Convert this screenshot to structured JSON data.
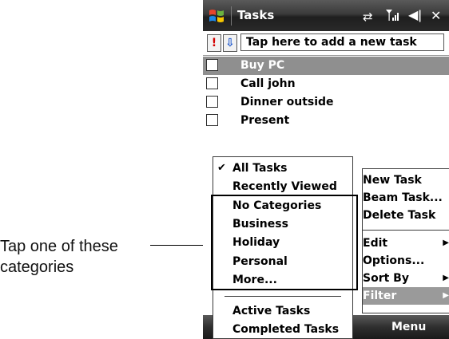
{
  "titlebar": {
    "title": "Tasks",
    "close_label": "✕"
  },
  "toolbar": {
    "priority_label": "!",
    "sort_label": "⇩",
    "new_task_placeholder": "Tap here to add a new task"
  },
  "tasks": [
    {
      "label": "Buy PC",
      "selected": true
    },
    {
      "label": "Call john",
      "selected": false
    },
    {
      "label": "Dinner outside",
      "selected": false
    },
    {
      "label": "Present",
      "selected": false
    }
  ],
  "filter_menu": {
    "items": [
      "All Tasks",
      "Recently Viewed",
      "No Categories",
      "Business",
      "Holiday",
      "Personal",
      "More..."
    ],
    "status_items": [
      "Active Tasks",
      "Completed Tasks"
    ],
    "checked_item": "All Tasks"
  },
  "main_menu": {
    "items": [
      "New Task",
      "Beam Task...",
      "Delete Task",
      "Edit",
      "Options...",
      "Sort By",
      "Filter"
    ],
    "active_item": "Filter"
  },
  "softkeys": {
    "right": "Menu"
  },
  "callout": {
    "line1": "Tap one of these",
    "line2": "categories"
  },
  "colors": {
    "titlebar": "#2a2a2a",
    "selection": "#8f8f8f",
    "priority": "#d40000",
    "sort_arrow": "#1a55cc"
  },
  "icons": [
    "windows-start-icon",
    "sync-icon",
    "signal-icon",
    "volume-icon",
    "close-icon",
    "check-icon",
    "submenu-arrow-icon"
  ]
}
